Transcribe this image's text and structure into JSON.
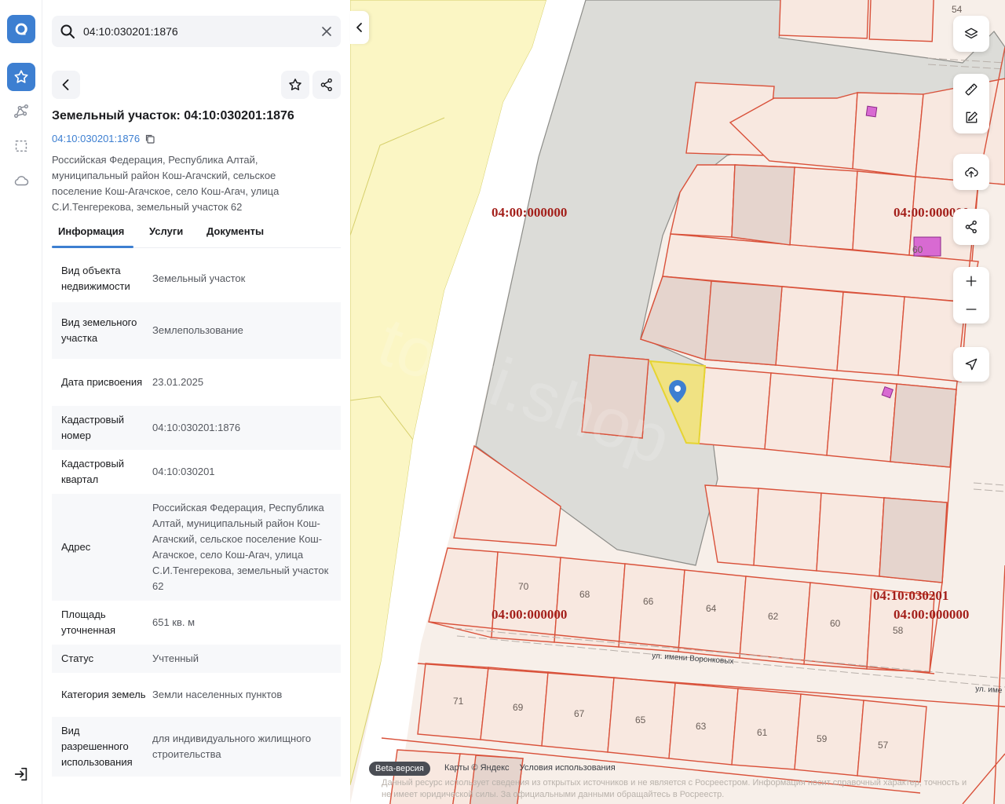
{
  "search": {
    "value": "04:10:030201:1876",
    "placeholder": ""
  },
  "panel": {
    "title": "Земельный участок: 04:10:030201:1876",
    "cadastral_link": "04:10:030201:1876",
    "address_short": "Российская Федерация, Республика Алтай, муниципальный район Кош-Агачский, сельское поселение Кош-Агачское, село Кош-Агач, улица С.И.Тенгерекова, земельный участок 62",
    "tabs": [
      {
        "label": "Информация"
      },
      {
        "label": "Услуги"
      },
      {
        "label": "Документы"
      }
    ],
    "active_tab": "Информация",
    "info": [
      {
        "key": "Вид объекта недвижимости",
        "value": "Земельный участок"
      },
      {
        "key": "Вид земельного участка",
        "value": "Землепользование"
      },
      {
        "key": "Дата присвоения",
        "value": "23.01.2025"
      },
      {
        "key": "Кадастровый номер",
        "value": "04:10:030201:1876"
      },
      {
        "key": "Кадастровый квартал",
        "value": "04:10:030201"
      },
      {
        "key": "Адрес",
        "value": "Российская Федерация, Республика Алтай, муниципальный район Кош-Агачский, сельское поселение Кош-Агачское, село Кош-Агач, улица С.И.Тенгерекова, земельный участок 62"
      },
      {
        "key": "Площадь уточненная",
        "value": "651 кв. м"
      },
      {
        "key": "Статус",
        "value": "Учтенный"
      },
      {
        "key": "Категория земель",
        "value": "Земли населенных пунктов"
      },
      {
        "key": "Вид разрешенного использования",
        "value": "для индивидуального жилищного строительства"
      }
    ]
  },
  "map": {
    "quarter_labels": [
      "04:00:000000",
      "04:00:000000",
      "04:00:000000",
      "04:00:000000",
      "04:10:030201"
    ],
    "street_labels": [
      "ул. имени Воронковых",
      "ул. име"
    ],
    "parcel_numbers": [
      "54",
      "60",
      "70",
      "68",
      "66",
      "64",
      "62",
      "60",
      "58",
      "71",
      "69",
      "67",
      "65",
      "63",
      "61",
      "59",
      "57"
    ],
    "watermark": "torgi.shop",
    "beta_label": "Beta-версия",
    "credits": [
      "Карты © Яндекс",
      "Условия использования"
    ],
    "disclaimer": "Данный ресурс использует сведения из открытых источников и не является с Росреестром. Информация носит справочный характер, точность и не имеет юридической силы. За официальными данными обращайтесь в Росреестр."
  },
  "colors": {
    "accent": "#3d7fd1",
    "parcel_outline": "#d9513a",
    "parcel_fill": "#f8e8e0",
    "selected_parcel": "#f2e27a",
    "quarter_label": "#a31f1a"
  }
}
